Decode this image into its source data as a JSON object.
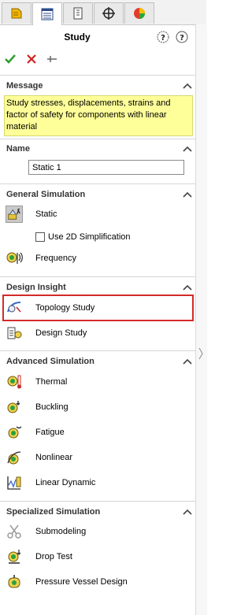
{
  "tabs": [
    {
      "icon": "feature-manager-icon"
    },
    {
      "icon": "property-manager-icon"
    },
    {
      "icon": "configuration-manager-icon"
    },
    {
      "icon": "dimxpert-icon"
    },
    {
      "icon": "display-manager-icon"
    }
  ],
  "panel": {
    "title": "Study",
    "help_icon": "help-whats-wrong-icon",
    "question_icon": "help-icon"
  },
  "actions": {
    "ok": "ok-checkmark-icon",
    "cancel": "cancel-x-icon",
    "pin": "pushpin-icon"
  },
  "message": {
    "header": "Message",
    "lines": [
      "Study stresses, displacements, strains and",
      "factor of safety  for components with linear",
      "material"
    ]
  },
  "name_section": {
    "header": "Name",
    "value": "Static 1"
  },
  "general": {
    "header": "General Simulation",
    "items": [
      {
        "label": "Static",
        "icon": "static-study-icon",
        "selected": true
      },
      {
        "label": "Frequency",
        "icon": "frequency-study-icon"
      }
    ],
    "checkbox_label": "Use 2D Simplification"
  },
  "design_insight": {
    "header": "Design Insight",
    "items": [
      {
        "label": "Topology Study",
        "icon": "topology-study-icon",
        "highlighted": true
      },
      {
        "label": "Design Study",
        "icon": "design-study-icon"
      }
    ]
  },
  "advanced": {
    "header": "Advanced Simulation",
    "items": [
      {
        "label": "Thermal",
        "icon": "thermal-study-icon"
      },
      {
        "label": "Buckling",
        "icon": "buckling-study-icon"
      },
      {
        "label": "Fatigue",
        "icon": "fatigue-study-icon"
      },
      {
        "label": "Nonlinear",
        "icon": "nonlinear-study-icon"
      },
      {
        "label": "Linear Dynamic",
        "icon": "linear-dynamic-study-icon"
      }
    ]
  },
  "specialized": {
    "header": "Specialized Simulation",
    "items": [
      {
        "label": "Submodeling",
        "icon": "submodeling-study-icon"
      },
      {
        "label": "Drop Test",
        "icon": "drop-test-study-icon"
      },
      {
        "label": "Pressure Vessel Design",
        "icon": "pressure-vessel-study-icon"
      }
    ]
  },
  "colors": {
    "highlight_border": "#d42a2a",
    "message_bg": "#ffff99",
    "ok_green": "#2e9e2e",
    "cancel_red": "#d42020"
  }
}
